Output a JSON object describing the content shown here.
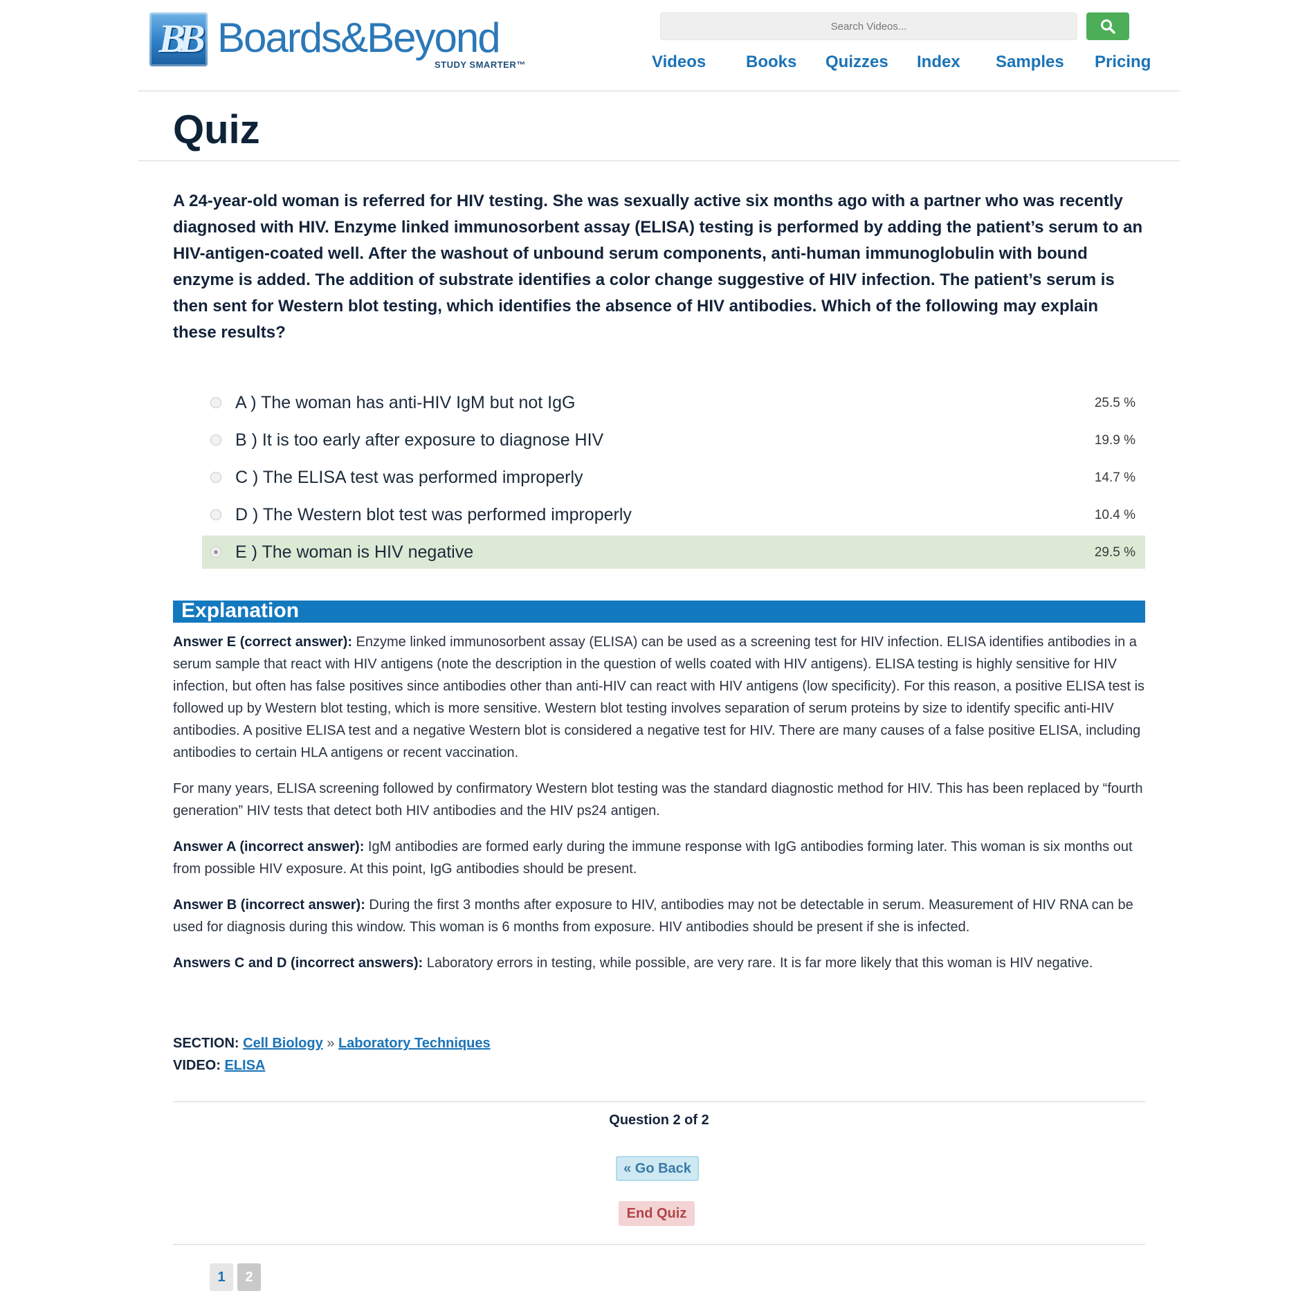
{
  "header": {
    "logo_word": "Boards&Beyond",
    "logo_mark": "BB",
    "logo_tagline": "STUDY SMARTER™",
    "search_placeholder": "Search Videos...",
    "search_icon": "magnifier-icon",
    "nav": [
      "Videos",
      "Books",
      "Quizzes",
      "Index",
      "Samples",
      "Pricing"
    ]
  },
  "page": {
    "title": "Quiz"
  },
  "question": {
    "text": "A 24-year-old woman is referred for HIV testing. She was sexually active six months ago with a partner who was recently diagnosed with HIV. Enzyme linked immunosorbent assay (ELISA) testing is performed by adding the patient’s serum to an HIV-antigen-coated well. After the washout of unbound serum components, anti-human immunoglobulin with bound enzyme is added. The addition of substrate identifies a color change suggestive of HIV infection. The patient’s serum is then sent for Western blot testing, which identifies the absence of HIV antibodies. Which of the following may explain these results?",
    "options": [
      {
        "label": "A ) The woman has anti-HIV IgM but not IgG",
        "percent": "25.5 %",
        "selected": false,
        "correct": false
      },
      {
        "label": "B ) It is too early after exposure to diagnose HIV",
        "percent": "19.9 %",
        "selected": false,
        "correct": false
      },
      {
        "label": "C ) The ELISA test was performed improperly",
        "percent": "14.7 %",
        "selected": false,
        "correct": false
      },
      {
        "label": "D ) The Western blot test was performed improperly",
        "percent": "10.4 %",
        "selected": false,
        "correct": false
      },
      {
        "label": "E ) The woman is HIV negative",
        "percent": "29.5 %",
        "selected": true,
        "correct": true
      }
    ],
    "correct_highlight_color": "#dce9d4"
  },
  "explanation": {
    "heading": "Explanation",
    "paragraphs": [
      {
        "lead": "Answer E (correct answer):",
        "text": " Enzyme linked immunosorbent assay (ELISA) can be used as a screening test for HIV infection. ELISA identifies antibodies in a serum sample that react with HIV antigens (note the description in the question of wells coated with HIV antigens). ELISA testing is highly sensitive for HIV infection, but often has false positives since antibodies other than anti-HIV can react with HIV antigens (low specificity). For this reason, a positive ELISA test is followed up by Western blot testing, which is more sensitive. Western blot testing involves separation of serum proteins by size to identify specific anti-HIV antibodies. A positive ELISA test and a negative Western blot is considered a negative test for HIV. There are many causes of a false positive ELISA, including antibodies to certain HLA antigens or recent vaccination."
      },
      {
        "lead": "",
        "text": "For many years, ELISA screening followed by confirmatory Western blot testing was the standard diagnostic method for HIV. This has been replaced by “fourth generation” HIV tests that detect both HIV antibodies and the HIV ps24 antigen."
      },
      {
        "lead": "Answer A (incorrect answer):",
        "text": " IgM antibodies are formed early during the immune response with IgG antibodies forming later. This woman is six months out from possible HIV exposure. At this point, IgG antibodies should be present."
      },
      {
        "lead": "Answer B (incorrect answer):",
        "text": " During the first 3 months after exposure to HIV, antibodies may not be detectable in serum. Measurement of HIV RNA can be used for diagnosis during this window. This woman is 6 months from exposure. HIV antibodies should be present if she is infected."
      },
      {
        "lead": "Answers C and D (incorrect answers):",
        "text": " Laboratory errors in testing, while possible, are very rare. It is far more likely that this woman is HIV negative."
      }
    ]
  },
  "meta": {
    "section_label": "SECTION:",
    "section_link1": "Cell Biology",
    "separator": "»",
    "section_link2": "Laboratory Techniques",
    "video_label": "VIDEO:",
    "video_link": "ELISA"
  },
  "footer": {
    "question_count": "Question 2 of 2",
    "back_label": "« Go Back",
    "end_label": "End Quiz",
    "pages": [
      "1",
      "2"
    ]
  },
  "colors": {
    "brand_blue": "#1a73b8",
    "explanation_bar": "#1379bf",
    "search_button": "#4cae57",
    "back_button": "#cfe9f3",
    "end_button": "#f3d3d4"
  }
}
